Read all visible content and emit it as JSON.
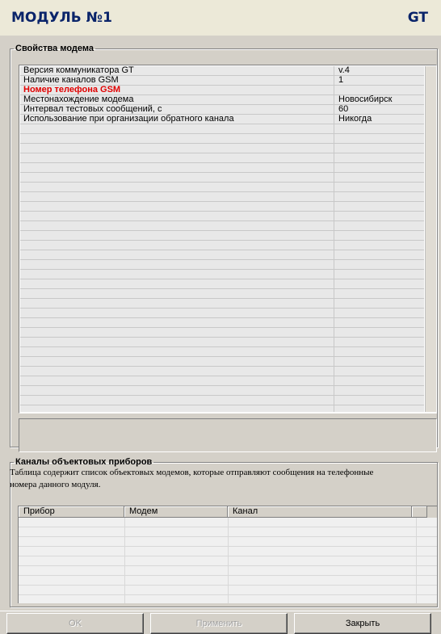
{
  "header": {
    "title": "МОДУЛЬ №1",
    "badge": "GT"
  },
  "modem_props": {
    "legend": "Свойства модема",
    "rows": [
      {
        "name": "Версия коммуникатора GT",
        "value": "v.4"
      },
      {
        "name": "Наличие каналов GSM",
        "value": "1"
      },
      {
        "name": "Номер телефона GSM",
        "value": "",
        "highlight": true
      },
      {
        "name": "Местонахождение модема",
        "value": "Новосибирск"
      },
      {
        "name": "Интервал тестовых сообщений, с",
        "value": "60"
      },
      {
        "name": "Использование при организации обратного канала",
        "value": "Никогда"
      }
    ]
  },
  "channels": {
    "legend": "Каналы объектовых приборов",
    "description": "Таблица содержит список объектовых модемов, которые отправляют сообщения на телефонные номера данного модуля.",
    "columns": [
      "Прибор",
      "Модем",
      "Канал"
    ]
  },
  "buttons": {
    "ok": "OK",
    "apply": "Применить",
    "close": "Закрыть"
  },
  "colors": {
    "title": "#0a246a",
    "highlight": "#e00000"
  }
}
